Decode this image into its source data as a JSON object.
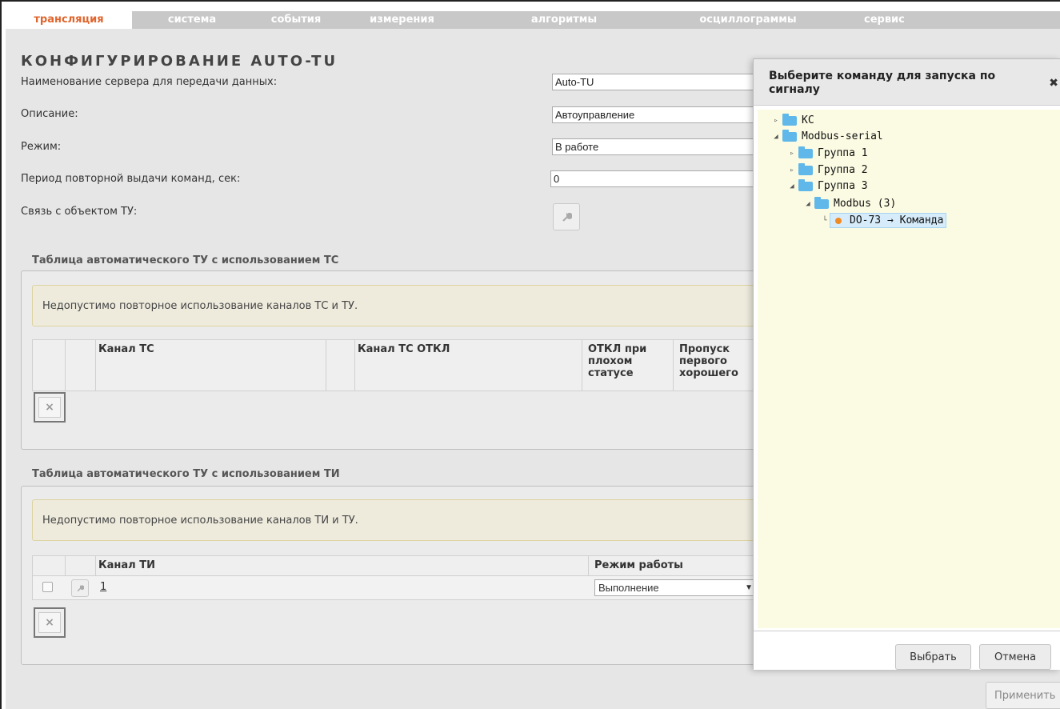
{
  "nav": {
    "tabs": [
      {
        "label": "трансляция",
        "active": true
      },
      {
        "label": "система",
        "active": false
      },
      {
        "label": "события",
        "active": false
      },
      {
        "label": "измерения",
        "active": false
      },
      {
        "label": "алгоритмы",
        "active": false
      },
      {
        "label": "осциллограммы",
        "active": false
      },
      {
        "label": "сервис",
        "active": false
      }
    ]
  },
  "page": {
    "title": "КОНФИГУРИРОВАНИЕ AUTO-TU",
    "server_name_label": "Наименование сервера для передачи данных:",
    "server_name_value": "Auto-TU",
    "description_label": "Описание:",
    "description_value": "Автоуправление",
    "mode_label": "Режим:",
    "mode_value": "В работе",
    "period_label": "Период повторной выдачи команд, сек:",
    "period_value": "0",
    "link_label": "Связь с объектом ТУ:",
    "apply_button": "Применить"
  },
  "ts_table": {
    "title": "Таблица автоматического ТУ с использованием ТС",
    "warning": "Недопустимо повторное использование каналов ТС и ТУ.",
    "col_channel": "Канал ТС",
    "col_channel_off": "Канал ТС ОТКЛ",
    "col_off_bad_line1": "ОТКЛ при",
    "col_off_bad_line2": "плохом",
    "col_off_bad_line3": "статусе",
    "col_skip_line1": "Пропуск",
    "col_skip_line2": "первого",
    "col_skip_line3": "хорошего"
  },
  "ti_table": {
    "title": "Таблица автоматического ТУ с использованием ТИ",
    "warning": "Недопустимо повторное использование каналов ТИ и ТУ.",
    "col_channel": "Канал ТИ",
    "col_mode": "Режим работы",
    "rows": [
      {
        "channel": "1",
        "mode": "Выполнение"
      }
    ]
  },
  "dialog": {
    "title": "Выберите команду для запуска по сигналу",
    "tree": {
      "ks": "КС",
      "modbus_serial": "Modbus-serial",
      "group1": "Группа 1",
      "group2": "Группа 2",
      "group3": "Группа 3",
      "modbus3": "Modbus (3)",
      "command": "DO-73 → Команда"
    },
    "select_button": "Выбрать",
    "cancel_button": "Отмена"
  },
  "icons": {
    "close": "close-icon",
    "wrench": "wrench-icon",
    "delete": "delete-icon",
    "folder": "folder-icon"
  },
  "colors": {
    "active_tab": "#e0642c",
    "folder": "#5fb7ea",
    "command_dot": "#f08a24",
    "dialog_body": "#fbfbe3"
  }
}
